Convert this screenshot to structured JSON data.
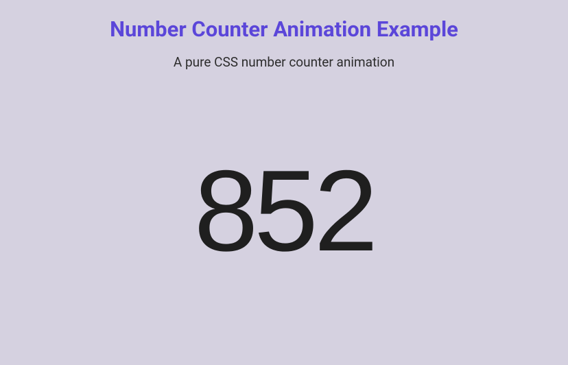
{
  "header": {
    "title": "Number Counter Animation Example",
    "subtitle": "A pure CSS number counter animation"
  },
  "counter": {
    "value": "852"
  }
}
